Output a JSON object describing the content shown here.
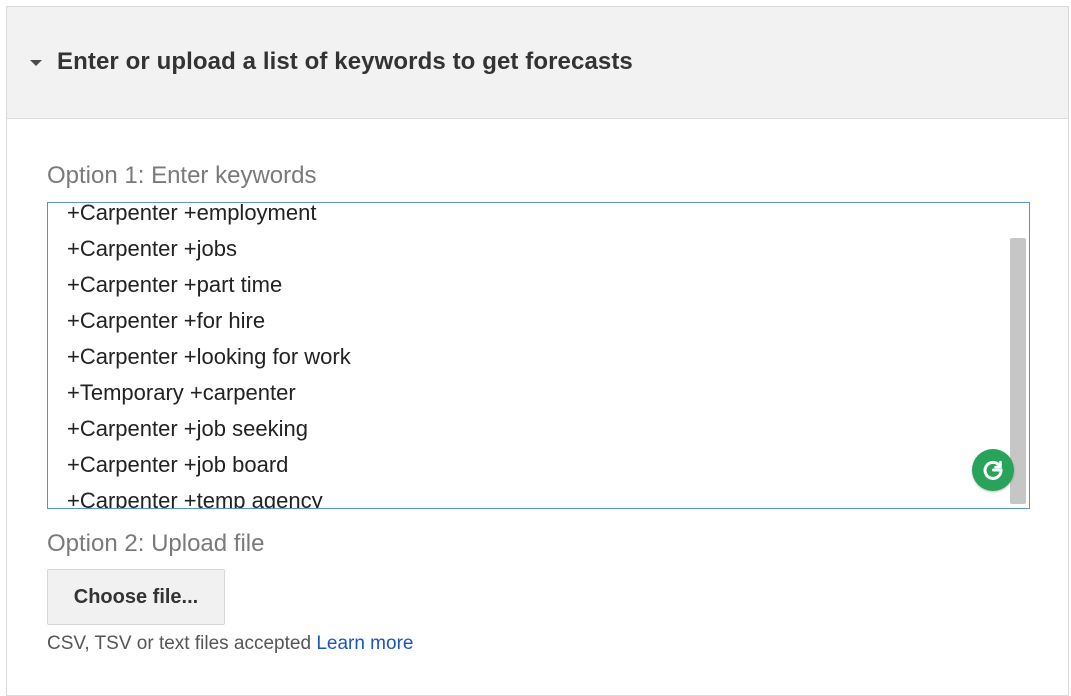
{
  "header": {
    "title": "Enter or upload a list of keywords to get forecasts",
    "caret_icon": "caret-down-icon"
  },
  "option1": {
    "label": "Option 1: Enter keywords",
    "keywords": [
      "+Carpenter +employment",
      "+Carpenter +jobs",
      "+Carpenter +part time",
      "+Carpenter +for hire",
      "+Carpenter +looking for work",
      "+Temporary +carpenter",
      "+Carpenter +job seeking",
      "+Carpenter +job board",
      "+Carpenter +temp agency"
    ],
    "extension_icon": "grammarly-icon"
  },
  "option2": {
    "label": "Option 2: Upload file",
    "choose_label": "Choose file...",
    "help_text": "CSV, TSV or text files accepted",
    "learn_more": "Learn more"
  },
  "colors": {
    "focus_border": "#5b8fd6",
    "link": "#1a55c4",
    "grammarly": "#27a35a"
  }
}
